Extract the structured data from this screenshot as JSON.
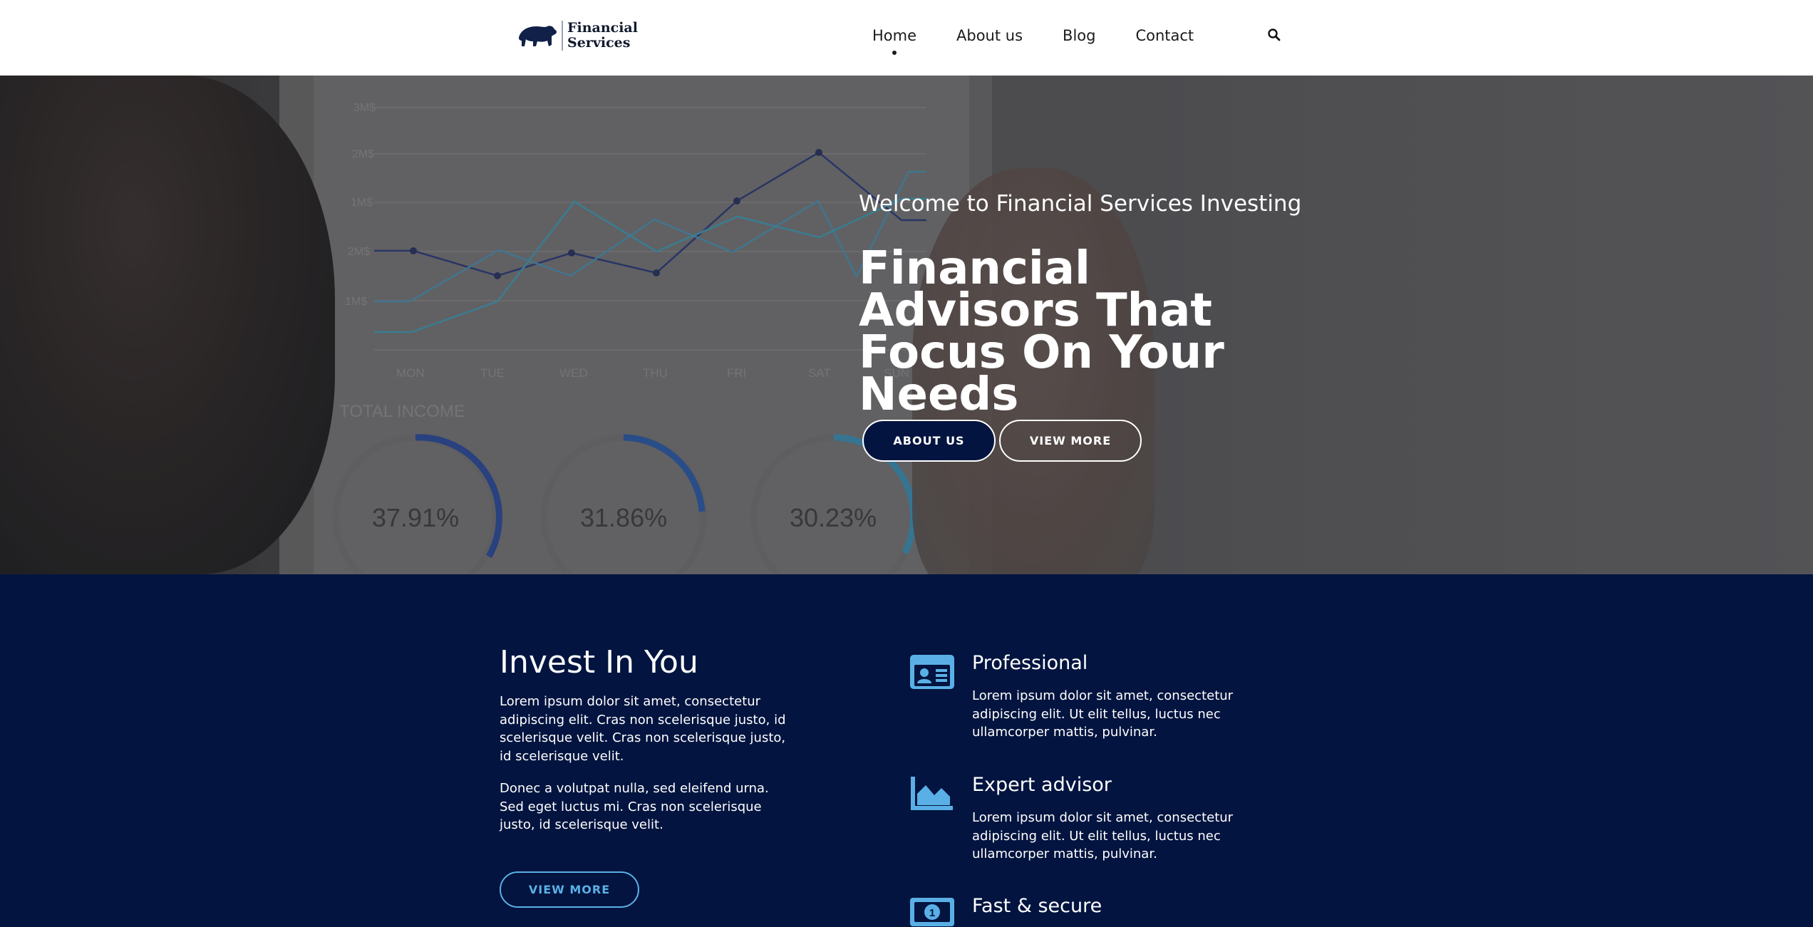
{
  "header": {
    "logo_line1": "Financial",
    "logo_line2": "Services",
    "nav": [
      "Home",
      "About us",
      "Blog",
      "Contact"
    ],
    "active_nav": "Home",
    "search_icon": "search-icon"
  },
  "hero": {
    "subtitle": "Welcome to Financial Services Investing",
    "title": "Financial Advisors That Focus On Your Needs",
    "buttons": {
      "about": "ABOUT US",
      "view": "VIEW MORE"
    },
    "background": {
      "days": [
        "MON",
        "TUE",
        "WED",
        "THU",
        "FRI",
        "SAT",
        "SUN"
      ],
      "y_labels": [
        "3M$",
        "2M$",
        "1M$",
        "2M$",
        "1M$"
      ],
      "income_label": "TOTAL INCOME",
      "percentages": [
        "37.91%",
        "31.86%",
        "30.23%"
      ]
    }
  },
  "invest": {
    "title": "Invest In You",
    "p1": "Lorem ipsum dolor sit amet, consectetur adipiscing elit. Cras non scelerisque justo, id scelerisque velit. Cras non scelerisque justo, id scelerisque velit.",
    "p2": "Donec a volutpat nulla, sed eleifend urna. Sed eget luctus mi. Cras non scelerisque justo, id scelerisque velit.",
    "button": "VIEW MORE"
  },
  "features": [
    {
      "title": "Professional",
      "text": "Lorem ipsum dolor sit amet, consectetur adipiscing elit. Ut elit tellus, luctus nec ullamcorper mattis, pulvinar.",
      "icon": "id-card-icon"
    },
    {
      "title": "Expert advisor",
      "text": "Lorem ipsum dolor sit amet, consectetur adipiscing elit. Ut elit tellus, luctus nec ullamcorper mattis, pulvinar.",
      "icon": "area-chart-icon"
    },
    {
      "title": "Fast & secure",
      "text": "",
      "icon": "money-bill-icon"
    }
  ],
  "colors": {
    "navy": "#02143f",
    "accent_blue": "#5ab0e6",
    "white": "#ffffff"
  }
}
